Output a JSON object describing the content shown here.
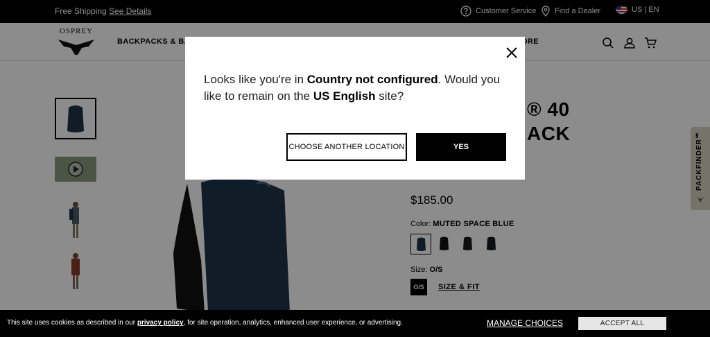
{
  "topbar": {
    "shipping_text": "Free Shipping",
    "shipping_link": "See Details",
    "customer_service": "Customer Service",
    "find_dealer": "Find a Dealer",
    "locale": "US | EN"
  },
  "header": {
    "logo_text": "OSPREY",
    "nav": [
      "BACKPACKS & BAG",
      "ORE"
    ]
  },
  "product": {
    "title_line1": "® 40",
    "title_line2": "ACK",
    "price": "$185.00",
    "color_label": "Color:",
    "color_value": "MUTED SPACE BLUE",
    "size_label": "Size:",
    "size_value": "O/S",
    "size_option": "O/S",
    "size_fit": "SIZE & FIT",
    "swatch_color": "#1e3349"
  },
  "packfinder": {
    "label": "PACKFINDER℠"
  },
  "modal": {
    "msg_a": "Looks like you're in ",
    "msg_b": "Country not configured",
    "msg_c": ". Would you like to remain on the ",
    "msg_d": "US English",
    "msg_e": " site?",
    "choose_label": "CHOOSE ANOTHER LOCATION",
    "yes_label": "YES"
  },
  "cookie": {
    "text_a": "This site uses cookies as described in our ",
    "link": "privacy policy",
    "text_b": ", for site operation, analytics, enhanced user experience, or advertising.",
    "manage": "MANAGE CHOICES",
    "accept": "ACCEPT ALL"
  }
}
